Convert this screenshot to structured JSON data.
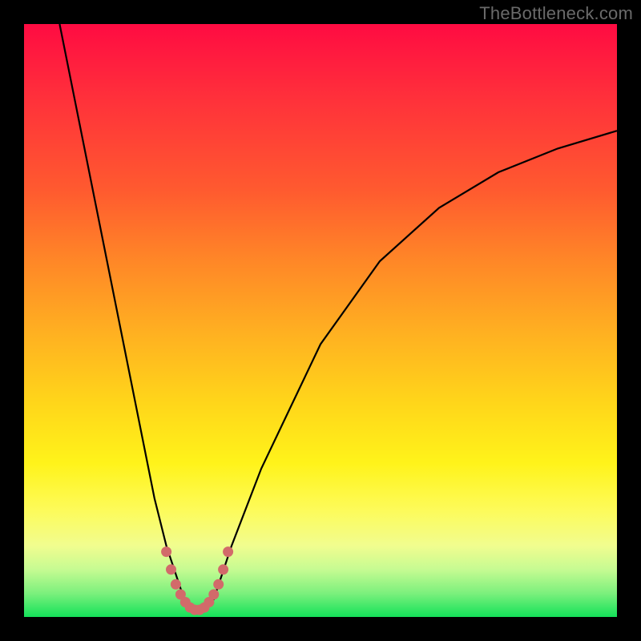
{
  "watermark": "TheBottleneck.com",
  "chart_data": {
    "type": "line",
    "title": "",
    "xlabel": "",
    "ylabel": "",
    "xlim": [
      0,
      100
    ],
    "ylim": [
      0,
      100
    ],
    "series": [
      {
        "name": "bottleneck-curve",
        "x": [
          6,
          10,
          14,
          18,
          22,
          24,
          26,
          27,
          28,
          29,
          30,
          31,
          32,
          33,
          35,
          40,
          50,
          60,
          70,
          80,
          90,
          100
        ],
        "y": [
          100,
          80,
          60,
          40,
          20,
          12,
          6,
          3,
          1.5,
          1,
          1,
          1.5,
          3,
          6,
          12,
          25,
          46,
          60,
          69,
          75,
          79,
          82
        ]
      },
      {
        "name": "highlight-segment",
        "x": [
          24.0,
          24.8,
          25.6,
          26.4,
          27.2,
          28.0,
          28.8,
          29.6,
          30.4,
          31.2,
          32.0,
          32.8,
          33.6,
          34.4
        ],
        "y": [
          11.0,
          8.0,
          5.5,
          3.8,
          2.5,
          1.6,
          1.2,
          1.2,
          1.6,
          2.5,
          3.8,
          5.5,
          8.0,
          11.0
        ]
      }
    ],
    "gradient_stops": [
      {
        "pos": 0,
        "color": "#ff0b42"
      },
      {
        "pos": 12,
        "color": "#ff2f3b"
      },
      {
        "pos": 28,
        "color": "#ff5a2f"
      },
      {
        "pos": 40,
        "color": "#ff8727"
      },
      {
        "pos": 52,
        "color": "#ffb021"
      },
      {
        "pos": 64,
        "color": "#ffd61a"
      },
      {
        "pos": 74,
        "color": "#fff31a"
      },
      {
        "pos": 82,
        "color": "#fdfb5a"
      },
      {
        "pos": 88,
        "color": "#f1fd8f"
      },
      {
        "pos": 92,
        "color": "#c6fb92"
      },
      {
        "pos": 96,
        "color": "#7cf07d"
      },
      {
        "pos": 100,
        "color": "#14e159"
      }
    ],
    "curve_color": "#000000",
    "highlight_color": "#d26a6a"
  }
}
